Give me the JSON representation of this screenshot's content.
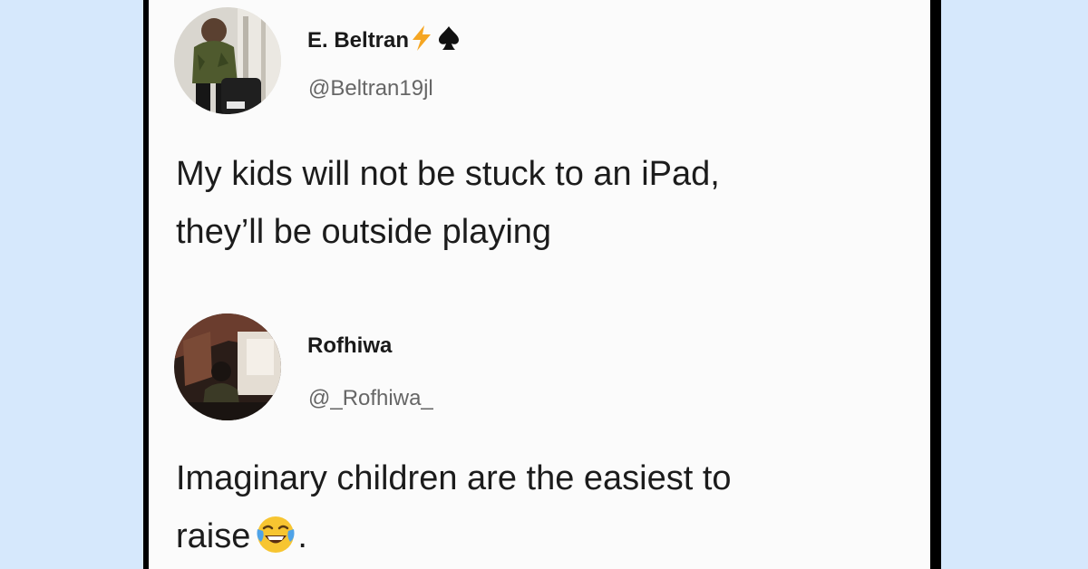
{
  "tweets": [
    {
      "display_name": "E. Beltran",
      "handle": "@Beltran19jl",
      "badges": [
        "lightning-icon",
        "spade-icon"
      ],
      "text_lines": [
        "My kids will not be stuck to an iPad,",
        "they’ll be outside playing"
      ]
    },
    {
      "display_name": "Rofhiwa",
      "handle": "@_Rofhiwa_",
      "text_lines": [
        "Imaginary children are the easiest to",
        "raise"
      ],
      "trailing_emoji": "tears-of-joy-emoji-icon",
      "trailing_text": "."
    }
  ],
  "colors": {
    "page_background": "#d6e8fc",
    "card_background": "#fbfbfb",
    "frame": "#000000",
    "lightning": "#f5a623"
  }
}
